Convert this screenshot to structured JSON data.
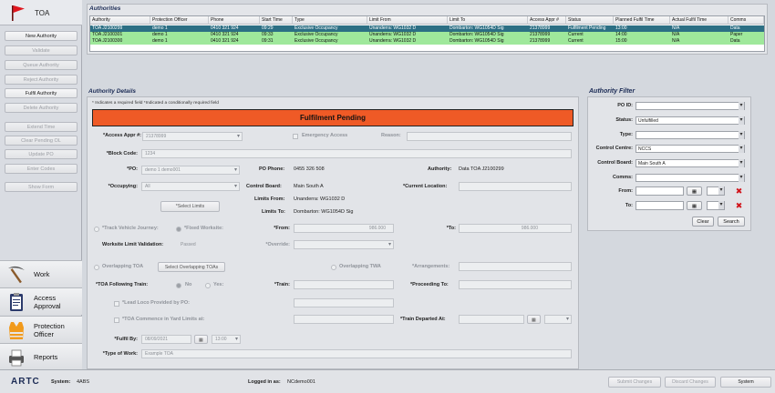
{
  "sidebar": {
    "title": "TOA",
    "buttons": [
      {
        "label": "New Authority",
        "enabled": true
      },
      {
        "label": "Validate",
        "enabled": false
      },
      {
        "label": "Queue Authority",
        "enabled": false
      },
      {
        "label": "Reject Authority",
        "enabled": false
      },
      {
        "label": "Fulfil Authority",
        "enabled": true
      },
      {
        "label": "Delete Authority",
        "enabled": false
      },
      {
        "label": "Extend Time",
        "enabled": false
      },
      {
        "label": "Clear Pending OL",
        "enabled": false
      },
      {
        "label": "Update PO",
        "enabled": false
      },
      {
        "label": "Enter Codes",
        "enabled": false
      },
      {
        "label": "Show Form",
        "enabled": false
      }
    ],
    "nav": [
      {
        "label1": "Work",
        "label2": "",
        "icon": "pickaxe-icon"
      },
      {
        "label1": "Access",
        "label2": "Approval",
        "icon": "clipboard-icon"
      },
      {
        "label1": "Protection",
        "label2": "Officer",
        "icon": "safety-vest-icon"
      },
      {
        "label1": "Reports",
        "label2": "",
        "icon": "reports-icon"
      }
    ]
  },
  "authorities": {
    "title": "Authorities",
    "columns": [
      "Authority",
      "Protection Officer",
      "Phone",
      "Start Time",
      "Type",
      "Limit From",
      "Limit To",
      "Access Appr #",
      "Status",
      "Planned Fulfil Time",
      "Actual Fulfil Time",
      "Comms"
    ],
    "rows": [
      [
        "TOA J2100299",
        "demo 1",
        "0410 321 924",
        "09:29",
        "Exclusive Occupancy",
        "Unanderra: WG1032 D",
        "Dombarton: WG1054D Sig",
        "21378999",
        "Fulfilment Pending",
        "13:00",
        "N/A",
        "Data"
      ],
      [
        "TOA J2100301",
        "demo 1",
        "0410 321 924",
        "09:33",
        "Exclusive Occupancy",
        "Unanderra: WG1032 D",
        "Dombarton: WG1054D Sig",
        "21378999",
        "Current",
        "14:00",
        "N/A",
        "Paper"
      ],
      [
        "TOA J2100300",
        "demo 1",
        "0410 321 924",
        "09:31",
        "Exclusive Occupancy",
        "Unanderra: WG1032 D",
        "Dombarton: WG1054D Sig",
        "21378999",
        "Current",
        "15:00",
        "N/A",
        "Data"
      ]
    ]
  },
  "details": {
    "title": "Authority Details",
    "note": "* Indicates a required field  *Indicated a conditionally required field",
    "status": "Fulfilment Pending",
    "access_appr_label": "*Access Appr #:",
    "access_appr": "21378999",
    "emergency_label": "Emergency Access",
    "reason_label": "Reason:",
    "block_code_label": "*Block Code:",
    "block_code": "1234",
    "po_label": "*PO:",
    "po": "demo 1 demo001",
    "po_phone_label": "PO Phone:",
    "po_phone": "0455 326 508",
    "authority_label": "Authority:",
    "authority": "Data TOA J2100299",
    "occupying_label": "*Occupying:",
    "occupying": "All",
    "control_board_label": "Control Board:",
    "control_board": "Main South A",
    "current_location_label": "*Current Location:",
    "limits_from_label": "Limits From:",
    "limits_from": "Unanderra: WG1032 D",
    "select_limits": "*Select Limits",
    "limits_to_label": "Limits To:",
    "limits_to": "Dombarton: WG1054D Sig",
    "track_vehicle": "*Track Vehicle Journey:",
    "fixed_worksite": "*Fixed Worksite:",
    "from_label": "*From:",
    "from_val": "986.000",
    "to_label": "*To:",
    "to_val": "986.000",
    "worksite_limit_label": "Worksite Limit Validation:",
    "worksite_limit": "Passed",
    "override_label": "*Override:",
    "overlapping_toa": "Overlapping TOA",
    "select_overlapping": "Select Overlapping TOAs",
    "overlapping_twa": "Overlapping TWA",
    "arrangements_label": "*Arrangements:",
    "toa_following_label": "*TOA Following Train:",
    "no": "No",
    "yes": "Yes:",
    "train_label": "*Train:",
    "proceeding_label": "*Proceeding To:",
    "lead_loco": "*Lead Loco Provided by PO:",
    "toa_commence": "*TOA Commence in Yard Limits at:",
    "train_departed_label": "*Train Departed At:",
    "fulfil_by_label": "*Fulfil By:",
    "fulfil_date": "08/09/2021",
    "fulfil_time": "13:00",
    "type_of_work_label": "*Type of Work:",
    "type_of_work": "Example TOA"
  },
  "filter": {
    "title": "Authority Filter",
    "po_id": "PO ID:",
    "status_label": "Status:",
    "status": "Unfulfilled",
    "type_label": "Type:",
    "control_centre_label": "Control Centre:",
    "control_centre": "NCCS",
    "control_board_label": "Control Board:",
    "control_board": "Main South A",
    "comms_label": "Comms:",
    "from_label": "From:",
    "to_label": "To:",
    "clear": "Clear",
    "search": "Search"
  },
  "bottom": {
    "logo": "ARTC",
    "system_label": "System:",
    "system": "4ABS",
    "logged_label": "Logged in as:",
    "logged": "NCdemo001",
    "submit": "Submit Changes",
    "discard": "Discard Changes",
    "system_btn": "System"
  },
  "colors": {
    "selected_row": "#2c6f84",
    "current_row": "#9fe89b",
    "status_bar": "#ef5a26"
  }
}
